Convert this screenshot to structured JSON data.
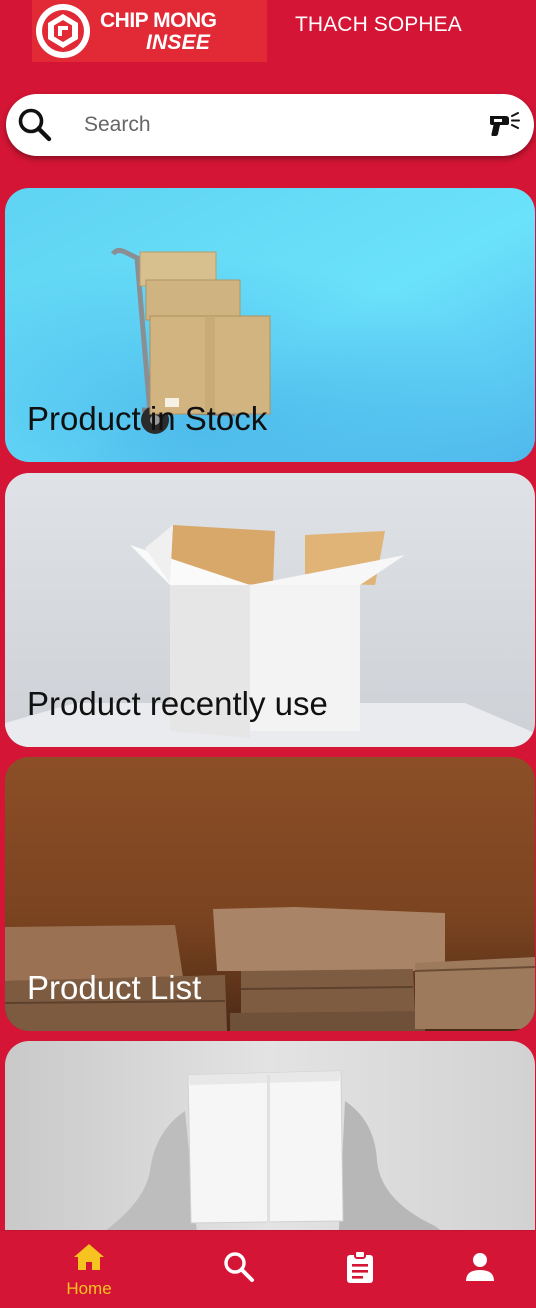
{
  "header": {
    "logo_line1": "CHIP MONG",
    "logo_line2": "INSEE",
    "user_name": "THACH SOPHEA"
  },
  "search": {
    "placeholder": "Search"
  },
  "cards": [
    {
      "label": "Product in Stock"
    },
    {
      "label": "Product recently use"
    },
    {
      "label": "Product List"
    },
    {
      "label": ""
    }
  ],
  "bottom_nav": {
    "items": [
      {
        "label": "Home",
        "icon": "home-icon",
        "active": true
      },
      {
        "label": "",
        "icon": "search-icon",
        "active": false
      },
      {
        "label": "",
        "icon": "clipboard-icon",
        "active": false
      },
      {
        "label": "",
        "icon": "person-icon",
        "active": false
      }
    ]
  },
  "colors": {
    "background": "#d41535",
    "accent": "#f7c321",
    "logo_bg": "#e22a36"
  }
}
